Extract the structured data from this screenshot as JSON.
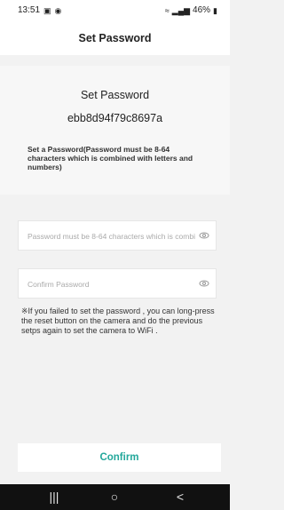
{
  "status_bar": {
    "time": "13:51",
    "battery": "46%",
    "icons": [
      "gallery-icon",
      "location-icon",
      "wifi-calling-icon",
      "signal-icon",
      "battery-icon"
    ]
  },
  "header": {
    "title": "Set Password"
  },
  "form": {
    "heading": "Set Password",
    "device_id": "ebb8d94f79c8697a",
    "instruction": "Set a Password(Password must be 8-64 characters which is combined with letters and numbers)",
    "password_placeholder": "Password must be 8-64 characters which is combi",
    "confirm_placeholder": "Confirm Password",
    "note": "※If you failed to set the password , you can long-press the reset button on the camera and do the previous setps again to set the camera to WiFi .",
    "confirm_label": "Confirm"
  },
  "system_nav": {
    "recent_label": "|||",
    "home_label": "○",
    "back_label": "<"
  },
  "colors": {
    "accent": "#23a89b",
    "background": "#f2f2f2"
  }
}
